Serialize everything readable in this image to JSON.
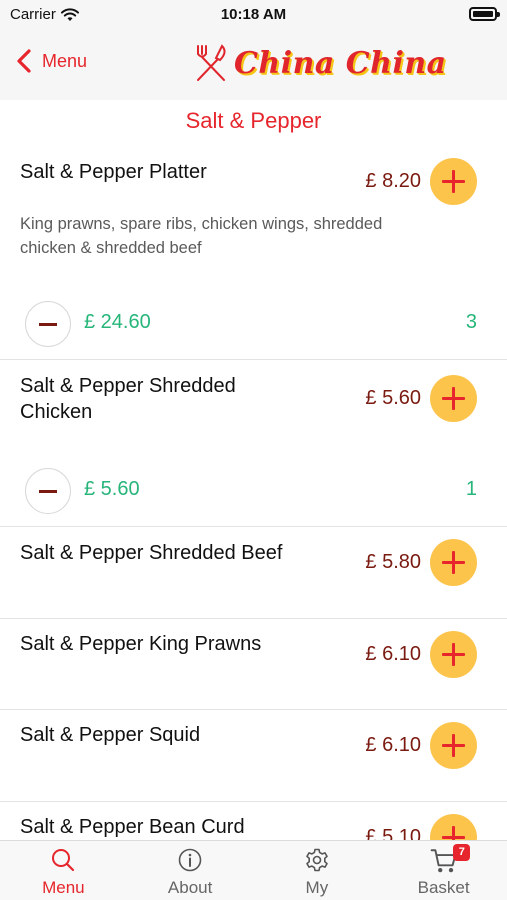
{
  "status_bar": {
    "carrier": "Carrier",
    "time": "10:18 AM"
  },
  "header": {
    "back_label": "Menu",
    "brand_name": "China China"
  },
  "section_title": "Salt & Pepper",
  "items": [
    {
      "name": "Salt & Pepper Platter",
      "price": "£ 8.20",
      "description": "King prawns, spare ribs, chicken wings, shredded chicken & shredded beef",
      "line_total": "£ 24.60",
      "quantity": "3"
    },
    {
      "name": "Salt & Pepper Shredded Chicken",
      "price": "£ 5.60",
      "line_total": "£ 5.60",
      "quantity": "1"
    },
    {
      "name": "Salt & Pepper Shredded Beef",
      "price": "£ 5.80"
    },
    {
      "name": "Salt & Pepper King Prawns",
      "price": "£ 6.10"
    },
    {
      "name": "Salt & Pepper Squid",
      "price": "£ 6.10"
    },
    {
      "name": "Salt & Pepper Bean Curd",
      "price": "£ 5.10"
    }
  ],
  "tabs": [
    {
      "label": "Menu",
      "icon": "search-icon",
      "active": true
    },
    {
      "label": "About",
      "icon": "info-icon"
    },
    {
      "label": "My",
      "icon": "gear-icon"
    },
    {
      "label": "Basket",
      "icon": "cart-icon",
      "badge": "7"
    }
  ],
  "colors": {
    "accent": "#e6262c",
    "add_button": "#fcc44a",
    "price": "#7a1a10",
    "quantity": "#27b57a"
  }
}
